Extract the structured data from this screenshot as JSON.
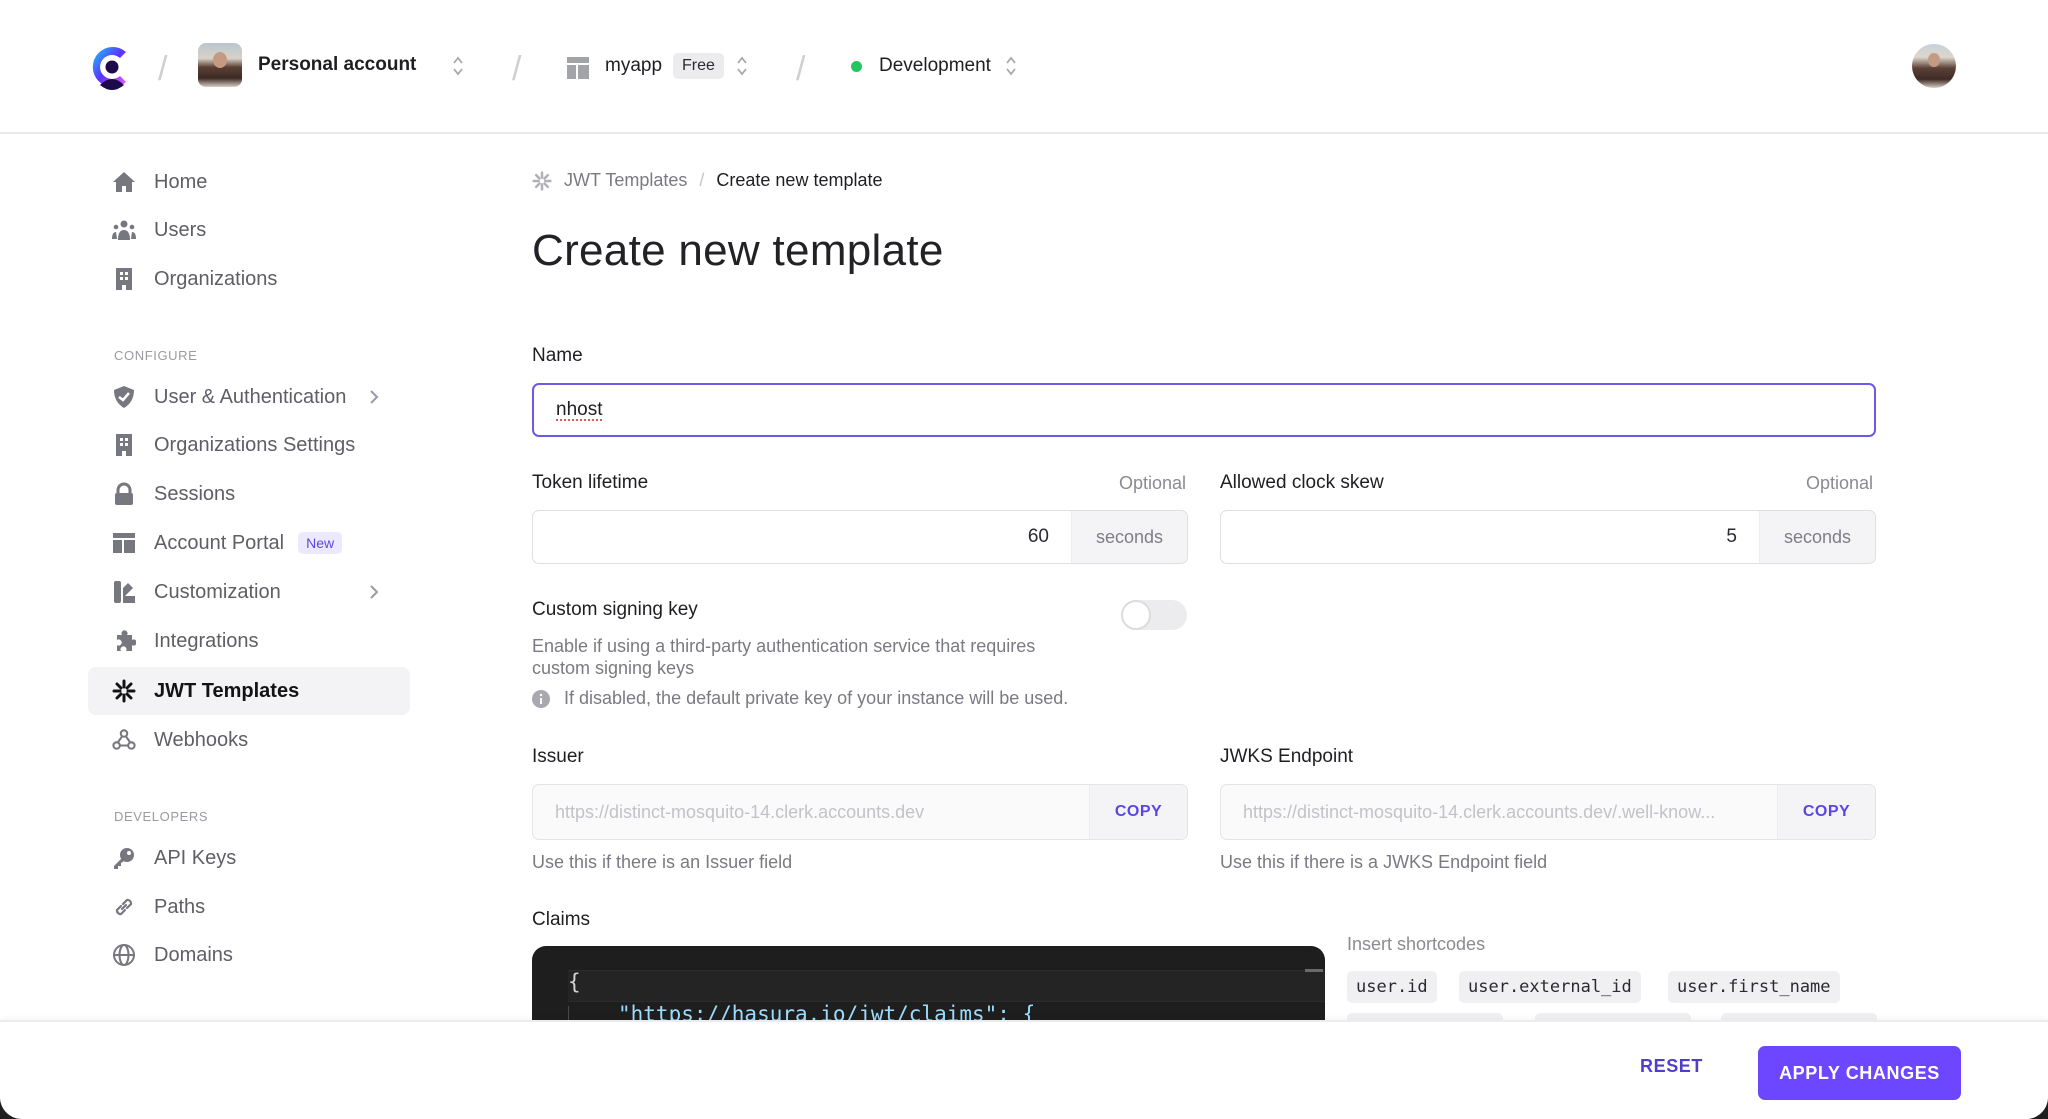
{
  "topbar": {
    "account_name": "Personal account",
    "app_name": "myapp",
    "app_plan_badge": "Free",
    "environment": "Development",
    "environment_color": "#22c55e",
    "separator": "/"
  },
  "sidebar": {
    "items": [
      {
        "label": "Home",
        "icon": "home-icon"
      },
      {
        "label": "Users",
        "icon": "users-icon"
      },
      {
        "label": "Organizations",
        "icon": "building-icon"
      }
    ],
    "configure_label": "CONFIGURE",
    "configure_items": [
      {
        "label": "User & Authentication",
        "icon": "shield-check-icon",
        "has_submenu": true
      },
      {
        "label": "Organizations Settings",
        "icon": "building-icon"
      },
      {
        "label": "Sessions",
        "icon": "lock-icon"
      },
      {
        "label": "Account Portal",
        "icon": "layout-icon",
        "badge": "New"
      },
      {
        "label": "Customization",
        "icon": "palette-icon",
        "has_submenu": true
      },
      {
        "label": "Integrations",
        "icon": "puzzle-icon"
      },
      {
        "label": "JWT Templates",
        "icon": "asterisk-icon",
        "active": true
      },
      {
        "label": "Webhooks",
        "icon": "webhook-icon"
      }
    ],
    "developers_label": "DEVELOPERS",
    "developer_items": [
      {
        "label": "API Keys",
        "icon": "key-icon"
      },
      {
        "label": "Paths",
        "icon": "link-icon"
      },
      {
        "label": "Domains",
        "icon": "globe-icon"
      }
    ]
  },
  "breadcrumb": {
    "parent": "JWT Templates",
    "separator": "/",
    "current": "Create new template"
  },
  "page": {
    "title": "Create new template"
  },
  "form": {
    "name": {
      "label": "Name",
      "value": "nhost"
    },
    "token_lifetime": {
      "label": "Token lifetime",
      "optional": "Optional",
      "value": "60",
      "unit": "seconds"
    },
    "clock_skew": {
      "label": "Allowed clock skew",
      "optional": "Optional",
      "value": "5",
      "unit": "seconds"
    },
    "custom_signing_key": {
      "label": "Custom signing key",
      "description": "Enable if using a third-party authentication service that requires custom signing keys",
      "info": "If disabled, the default private key of your instance will be used.",
      "enabled": false
    },
    "issuer": {
      "label": "Issuer",
      "value": "https://distinct-mosquito-14.clerk.accounts.dev",
      "copy_label": "COPY",
      "help": "Use this if there is an Issuer field"
    },
    "jwks": {
      "label": "JWKS Endpoint",
      "value": "https://distinct-mosquito-14.clerk.accounts.dev/.well-know...",
      "copy_label": "COPY",
      "help": "Use this if there is a JWKS Endpoint field"
    },
    "claims": {
      "label": "Claims",
      "lines": [
        "{",
        "\"https://hasura.io/jwt/claims\": {"
      ]
    },
    "shortcodes": {
      "title": "Insert shortcodes",
      "items": [
        "user.id",
        "user.external_id",
        "user.first_name"
      ]
    }
  },
  "footer": {
    "reset_label": "RESET",
    "apply_label": "APPLY CHANGES",
    "accent_color": "#6c47ff"
  }
}
